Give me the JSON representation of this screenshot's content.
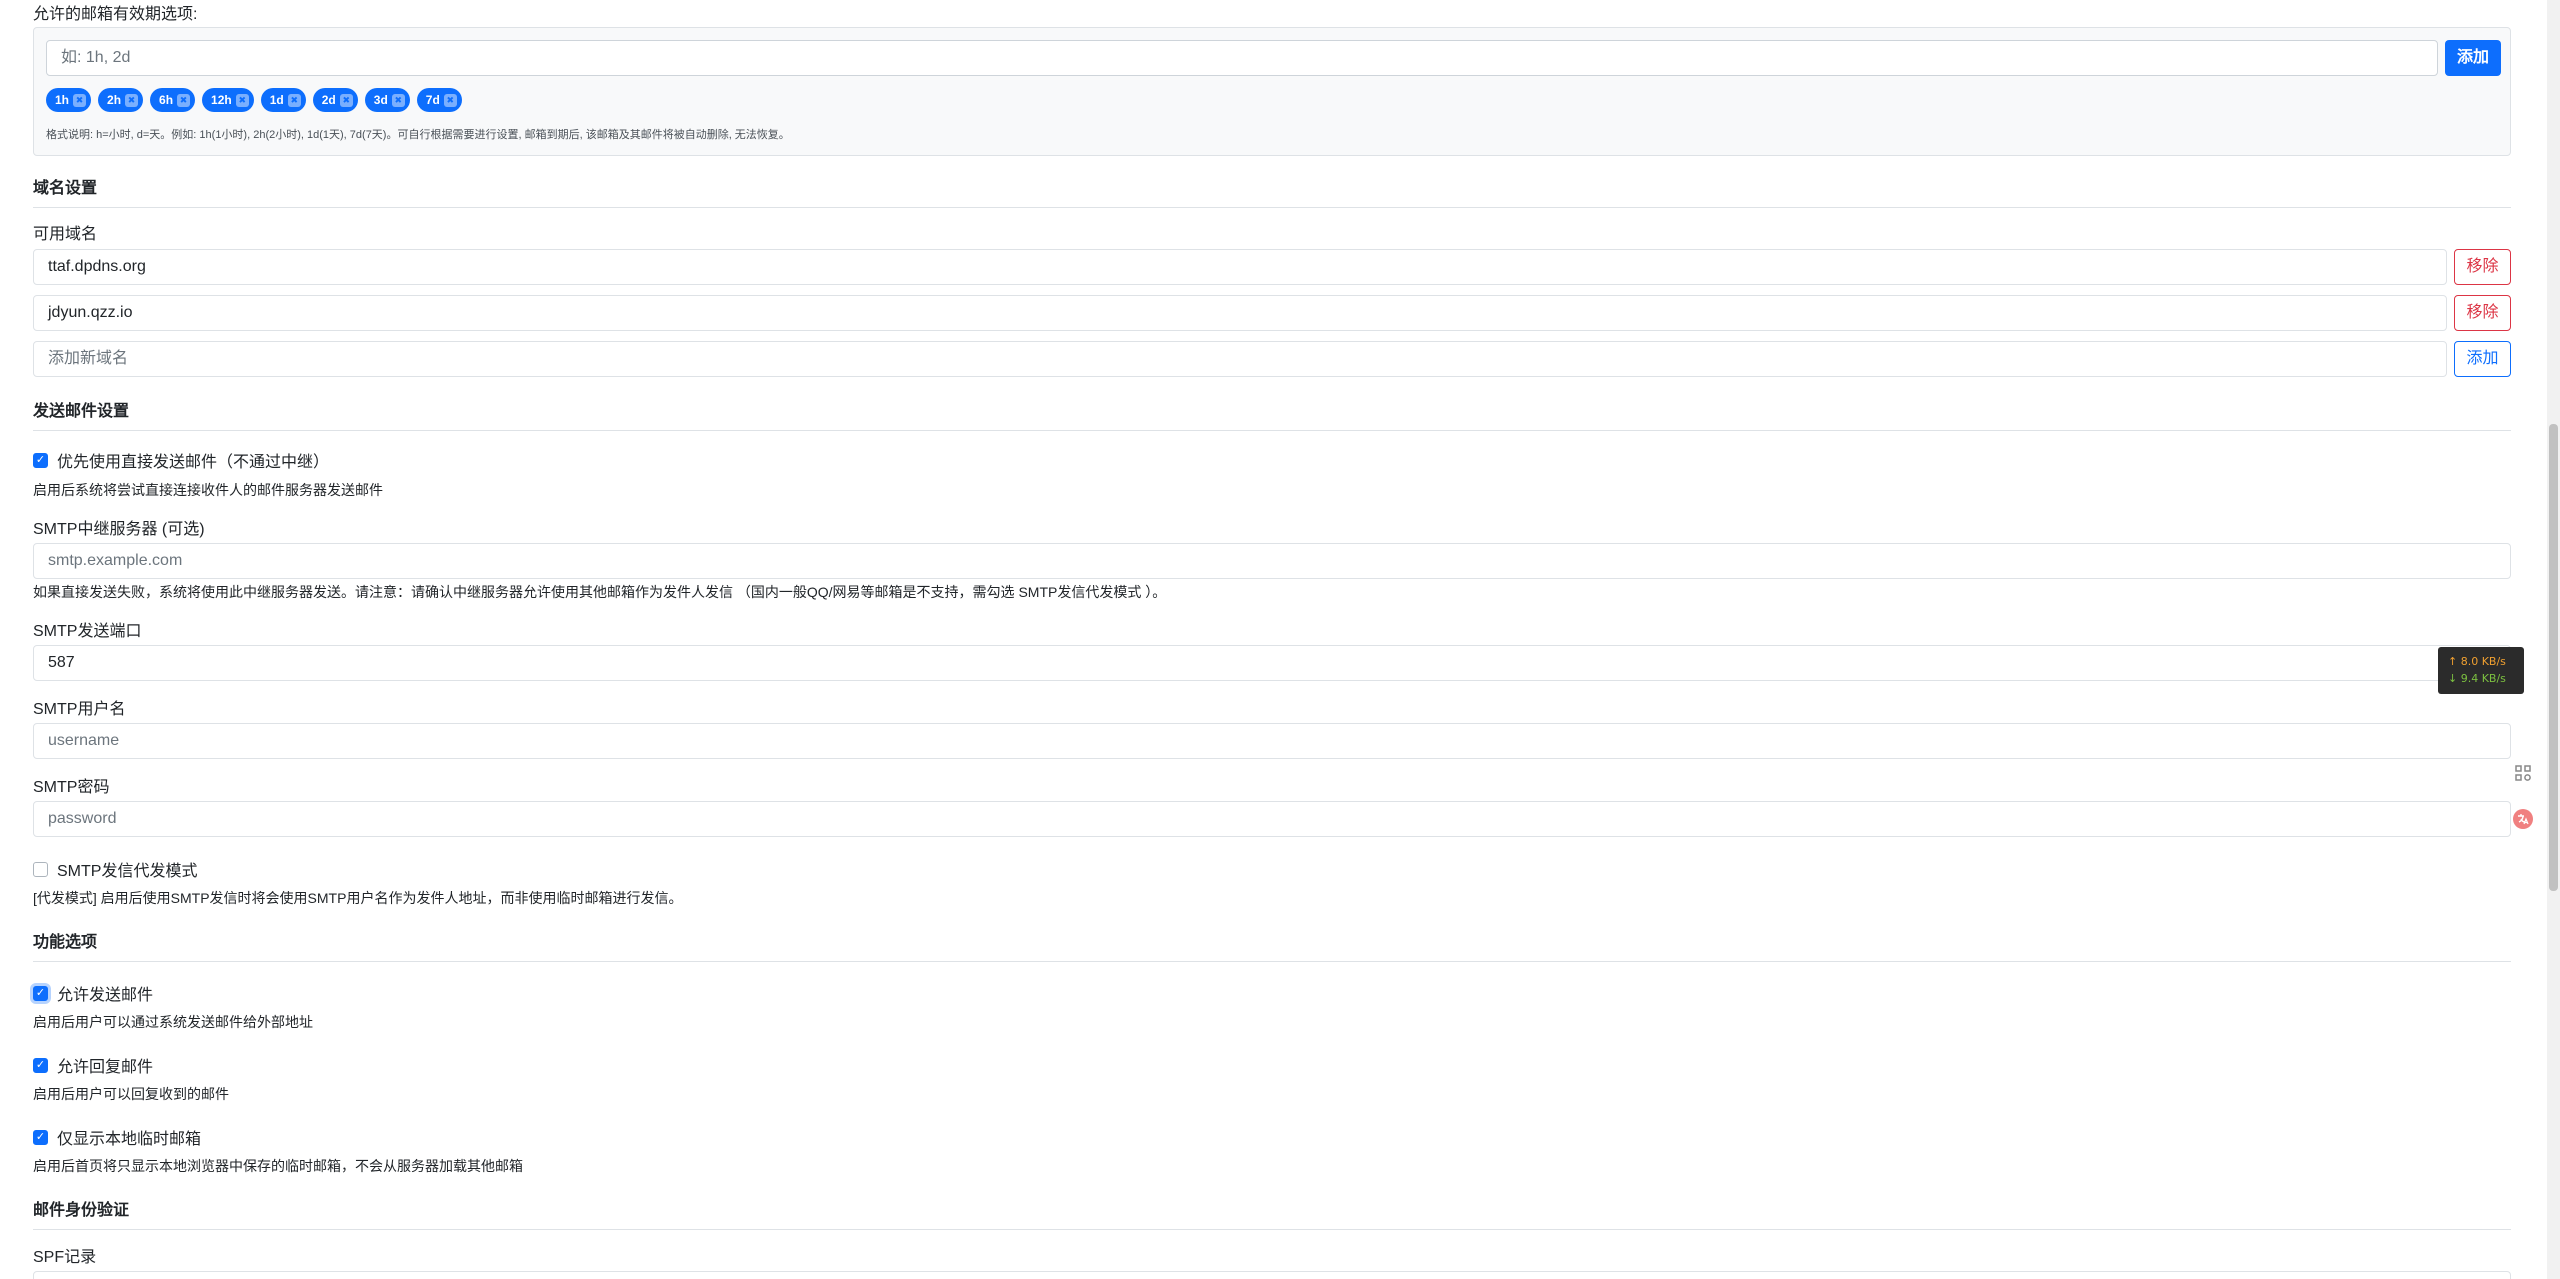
{
  "expiry": {
    "label": "允许的邮箱有效期选项:",
    "placeholder": "如: 1h, 2d",
    "add_label": "添加",
    "chips": [
      "1h",
      "2h",
      "6h",
      "12h",
      "1d",
      "2d",
      "3d",
      "7d"
    ],
    "remove_glyph": "✖",
    "hint": "格式说明: h=小时, d=天。例如: 1h(1小时), 2h(2小时), 1d(1天), 7d(7天)。可自行根据需要进行设置, 邮箱到期后, 该邮箱及其邮件将被自动删除, 无法恢复。"
  },
  "domain": {
    "section_title": "域名设置",
    "label": "可用域名",
    "items": [
      {
        "value": "ttaf.dpdns.org",
        "remove_label": "移除"
      },
      {
        "value": "jdyun.qzz.io",
        "remove_label": "移除"
      }
    ],
    "new_placeholder": "添加新域名",
    "add_label": "添加"
  },
  "send": {
    "section_title": "发送邮件设置",
    "direct_label": "优先使用直接发送邮件（不通过中继）",
    "direct_checked": true,
    "direct_help": "启用后系统将尝试直接连接收件人的邮件服务器发送邮件",
    "relay_label": "SMTP中继服务器 (可选)",
    "relay_placeholder": "smtp.example.com",
    "relay_help": "如果直接发送失败，系统将使用此中继服务器发送。请注意：请确认中继服务器允许使用其他邮箱作为发件人发信 （国内一般QQ/网易等邮箱是不支持，需勾选 SMTP发信代发模式 ）。",
    "port_label": "SMTP发送端口",
    "port_value": "587",
    "user_label": "SMTP用户名",
    "user_placeholder": "username",
    "pass_label": "SMTP密码",
    "pass_placeholder": "password",
    "proxy_label": "SMTP发信代发模式",
    "proxy_checked": false,
    "proxy_help": "[代发模式] 启用后使用SMTP发信时将会使用SMTP用户名作为发件人地址，而非使用临时邮箱进行发信。"
  },
  "features": {
    "section_title": "功能选项",
    "items": [
      {
        "label": "允许发送邮件",
        "checked": true,
        "help": "启用后用户可以通过系统发送邮件给外部地址"
      },
      {
        "label": "允许回复邮件",
        "checked": true,
        "help": "启用后用户可以回复收到的邮件"
      },
      {
        "label": "仅显示本地临时邮箱",
        "checked": true,
        "help": "启用后首页将只显示本地浏览器中保存的临时邮箱，不会从服务器加载其他邮箱"
      }
    ]
  },
  "auth": {
    "section_title": "邮件身份验证",
    "spf_label": "SPF记录"
  },
  "speed_widget": {
    "up": "↑ 8.0 KB/s",
    "down": "↓ 9.4 KB/s"
  },
  "check_glyph": "✓",
  "colors": {
    "primary": "#0d6efd",
    "danger": "#dc3545"
  }
}
